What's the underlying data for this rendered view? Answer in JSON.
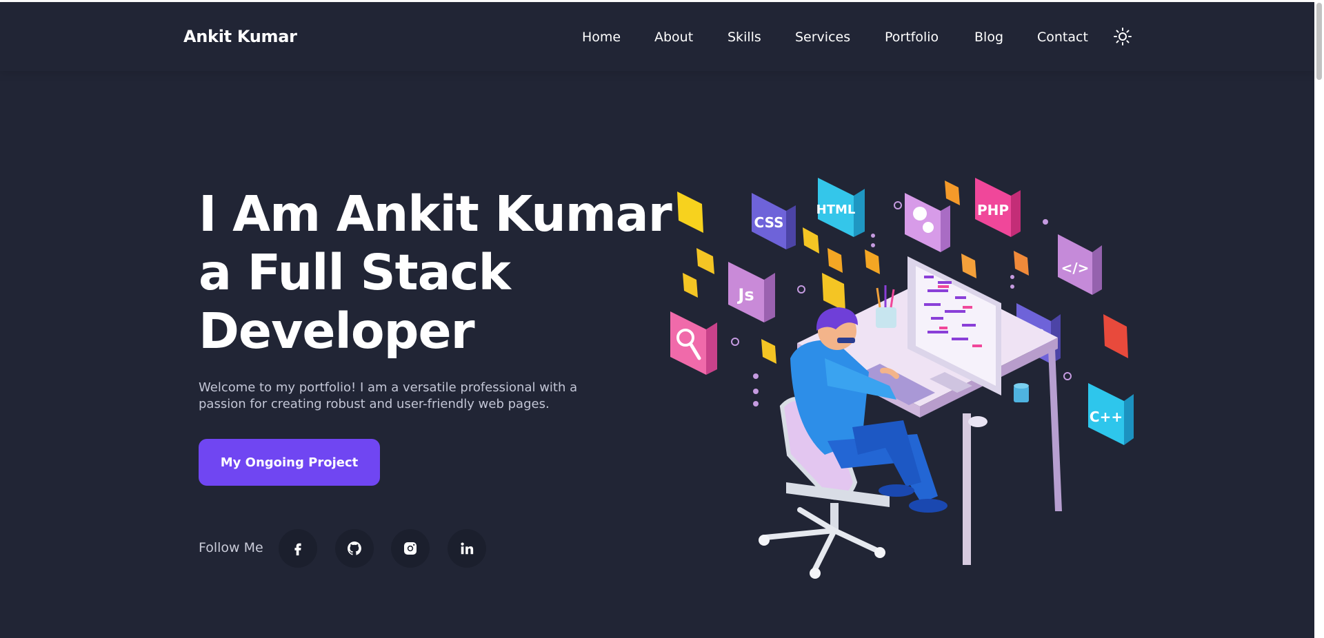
{
  "brand": {
    "name": "Ankit Kumar"
  },
  "nav": {
    "items": [
      {
        "label": "Home"
      },
      {
        "label": "About"
      },
      {
        "label": "Skills"
      },
      {
        "label": "Services"
      },
      {
        "label": "Portfolio"
      },
      {
        "label": "Blog"
      },
      {
        "label": "Contact"
      }
    ],
    "theme_toggle_icon": "sun-icon"
  },
  "hero": {
    "title_line1": "I Am Ankit Kumar",
    "title_line2": "a Full Stack",
    "title_line3": "Developer",
    "description": "Welcome to my portfolio! I am a versatile professional with a passion for creating robust and user-friendly web pages.",
    "cta_label": "My Ongoing Project"
  },
  "social": {
    "label": "Follow Me",
    "links": [
      {
        "icon": "facebook-icon"
      },
      {
        "icon": "github-icon"
      },
      {
        "icon": "instagram-icon"
      },
      {
        "icon": "linkedin-icon"
      }
    ]
  },
  "illustration": {
    "tiles": [
      "CSS",
      "HTML",
      "PHP",
      "Js",
      "</>",
      "{ }",
      "C++"
    ]
  },
  "colors": {
    "background": "#212535",
    "accent": "#7046f2",
    "text": "#ffffff",
    "muted_text": "#c3c6d6"
  }
}
